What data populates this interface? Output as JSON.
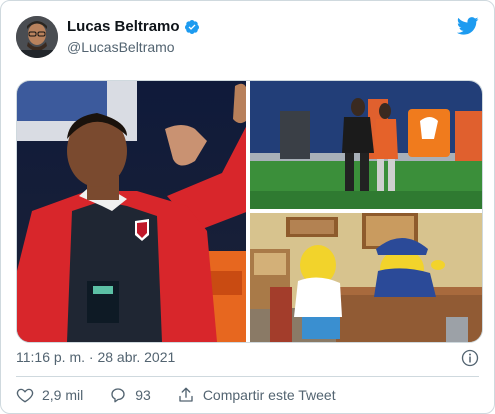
{
  "author": {
    "display_name": "Lucas Beltramo",
    "handle": "@LucasBeltramo",
    "verified": true
  },
  "media": {
    "count": 3,
    "images": [
      {
        "id": "left",
        "depicts": "coach-in-red-jacket"
      },
      {
        "id": "top-right",
        "depicts": "referee-on-field"
      },
      {
        "id": "bottom-right",
        "depicts": "cartoon-office-scene"
      }
    ]
  },
  "tweet": {
    "timestamp": "11:16 p. m. · 28 abr. 2021"
  },
  "actions": {
    "like_count": "2,9 mil",
    "reply_count": "93",
    "share_label": "Compartir este Tweet"
  },
  "colors": {
    "brand": "#1d9bf0",
    "muted_text": "#536471",
    "border": "#cfd9de"
  },
  "icons": [
    "twitter-bird-icon",
    "verified-badge-icon",
    "info-icon",
    "heart-icon",
    "reply-icon",
    "share-icon"
  ]
}
